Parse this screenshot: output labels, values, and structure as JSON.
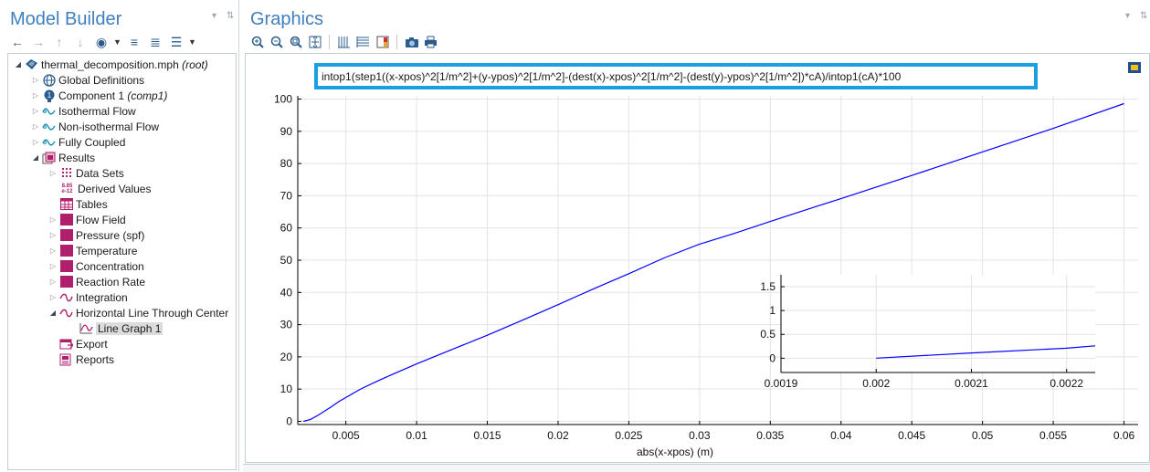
{
  "model_builder": {
    "title": "Model Builder",
    "tree": [
      {
        "label": "thermal_decomposition.mph",
        "suffix": "(root)",
        "icon": "model-root-icon"
      },
      {
        "label": "Global Definitions",
        "icon": "globe-icon"
      },
      {
        "label": "Component 1",
        "suffix": "(comp1)",
        "icon": "component-icon"
      },
      {
        "label": "Isothermal Flow",
        "icon": "flow-study-icon"
      },
      {
        "label": "Non-isothermal Flow",
        "icon": "flow-study-icon"
      },
      {
        "label": "Fully Coupled",
        "icon": "flow-study-icon"
      },
      {
        "label": "Results",
        "icon": "results-icon"
      },
      {
        "label": "Data Sets",
        "icon": "datasets-icon"
      },
      {
        "label": "Derived Values",
        "icon": "derived-values-icon",
        "icon_text_top": "8.85",
        "icon_text_bottom": "e-12"
      },
      {
        "label": "Tables",
        "icon": "table-icon"
      },
      {
        "label": "Flow Field",
        "icon": "plot-group-icon"
      },
      {
        "label": "Pressure (spf)",
        "icon": "plot-group-icon"
      },
      {
        "label": "Temperature",
        "icon": "plot-group-icon"
      },
      {
        "label": "Concentration",
        "icon": "plot-group-icon"
      },
      {
        "label": "Reaction Rate",
        "icon": "plot-group-icon"
      },
      {
        "label": "Integration",
        "icon": "1d-plot-group-icon"
      },
      {
        "label": "Horizontal Line Through Center",
        "icon": "1d-plot-group-icon"
      },
      {
        "label": "Line Graph 1",
        "icon": "line-graph-icon"
      },
      {
        "label": "Export",
        "icon": "export-icon"
      },
      {
        "label": "Reports",
        "icon": "reports-icon"
      }
    ]
  },
  "graphics": {
    "title": "Graphics",
    "expression": "intop1(step1((x-xpos)^2[1/m^2]+(y-ypos)^2[1/m^2]-(dest(x)-xpos)^2[1/m^2]-(dest(y)-ypos)^2[1/m^2])*cA)/intop1(cA)*100"
  },
  "colors": {
    "accent": "#3f7fbf",
    "title_border": "#1aa0e0",
    "curve": "#0000ff",
    "plot_group": "#b01f6b"
  },
  "chart_data": [
    {
      "type": "line",
      "title": "",
      "xlabel": "abs(x-xpos) (m)",
      "ylabel": "",
      "xlim": [
        0.0016,
        0.061
      ],
      "ylim": [
        -1,
        101
      ],
      "xticks": [
        0.005,
        0.01,
        0.015,
        0.02,
        0.025,
        0.03,
        0.035,
        0.04,
        0.045,
        0.05,
        0.055,
        0.06
      ],
      "yticks": [
        0,
        10,
        20,
        30,
        40,
        50,
        60,
        70,
        80,
        90,
        100
      ],
      "grid": true,
      "series": [
        {
          "x": [
            0.002,
            0.0025,
            0.003,
            0.0035,
            0.004,
            0.0045,
            0.005,
            0.006,
            0.007,
            0.008,
            0.01,
            0.0125,
            0.015,
            0.0175,
            0.02,
            0.0225,
            0.025,
            0.0275,
            0.03,
            0.0325,
            0.035,
            0.0375,
            0.04,
            0.045,
            0.05,
            0.055,
            0.06
          ],
          "y": [
            0,
            0.6,
            1.8,
            3.2,
            4.6,
            6.1,
            7.4,
            9.9,
            12.0,
            14.0,
            17.8,
            22.3,
            26.7,
            31.4,
            36.2,
            41.1,
            45.8,
            50.7,
            55.0,
            58.4,
            62.0,
            65.6,
            69.1,
            76.3,
            83.6,
            90.9,
            98.6
          ]
        }
      ]
    },
    {
      "type": "line",
      "title": "",
      "xlabel": "",
      "ylabel": "",
      "xlim": [
        0.0019,
        0.00223
      ],
      "ylim": [
        -0.3,
        1.75
      ],
      "xticks": [
        0.0019,
        0.002,
        0.0021,
        0.0022
      ],
      "yticks": [
        0,
        0.5,
        1,
        1.5
      ],
      "grid": true,
      "series": [
        {
          "x": [
            0.002,
            0.0021,
            0.0022,
            0.00223
          ],
          "y": [
            0,
            0.11,
            0.21,
            0.26
          ]
        }
      ]
    }
  ]
}
